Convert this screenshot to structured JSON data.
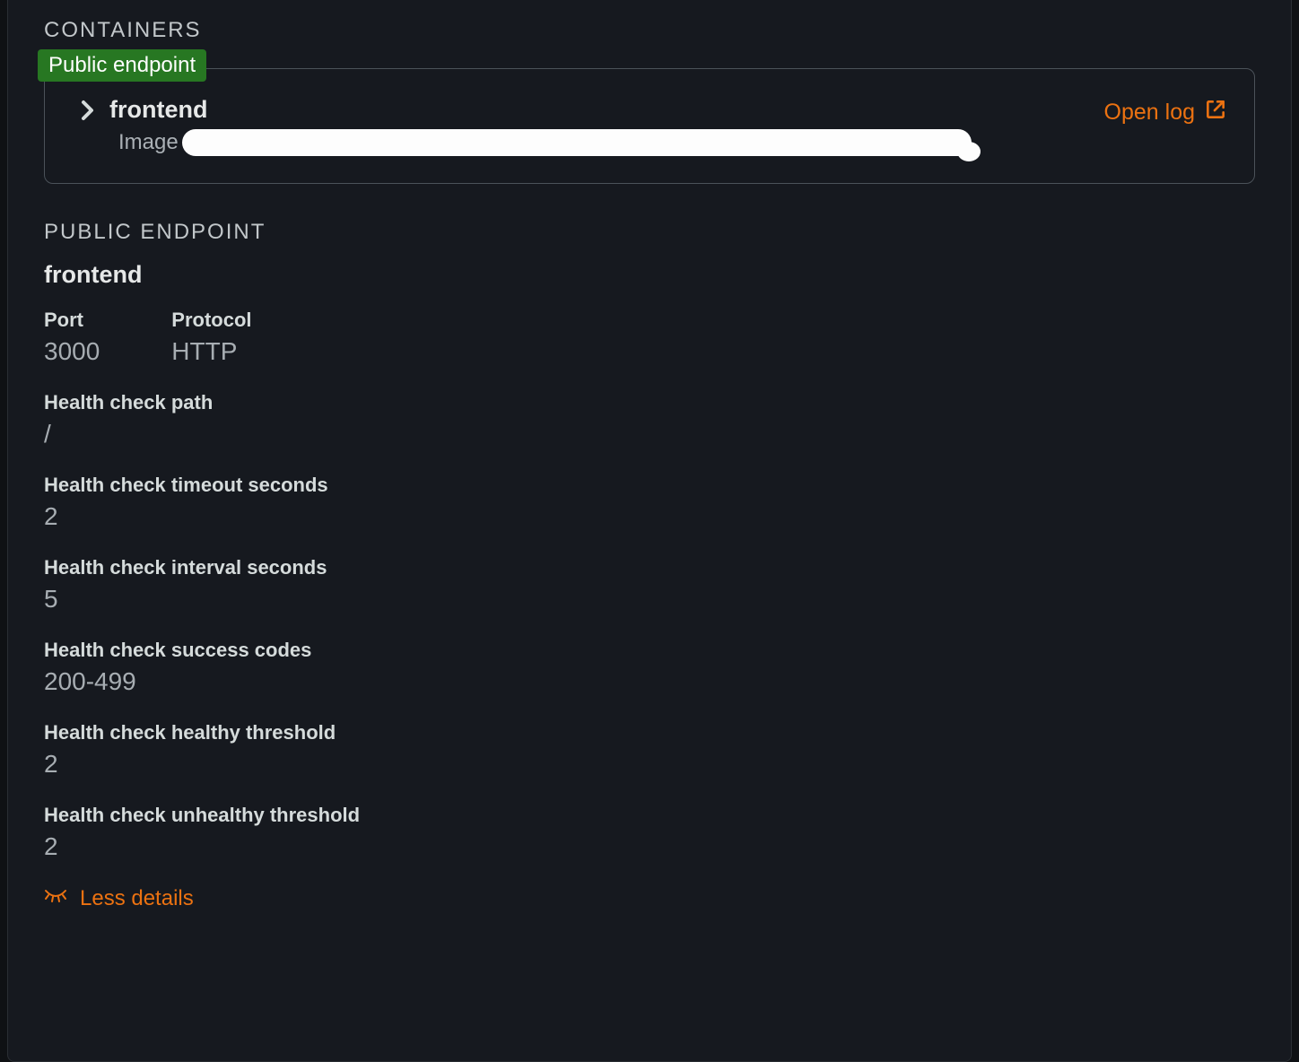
{
  "containers": {
    "section_label": "CONTAINERS",
    "badge": "Public endpoint",
    "name": "frontend",
    "image_label": "Image",
    "open_log_label": "Open log"
  },
  "public_endpoint": {
    "section_label": "PUBLIC ENDPOINT",
    "name": "frontend",
    "port_label": "Port",
    "port_value": "3000",
    "protocol_label": "Protocol",
    "protocol_value": "HTTP",
    "health_path_label": "Health check path",
    "health_path_value": "/",
    "health_timeout_label": "Health check timeout seconds",
    "health_timeout_value": "2",
    "health_interval_label": "Health check interval seconds",
    "health_interval_value": "5",
    "health_success_label": "Health check success codes",
    "health_success_value": "200-499",
    "health_healthy_label": "Health check healthy threshold",
    "health_healthy_value": "2",
    "health_unhealthy_label": "Health check unhealthy threshold",
    "health_unhealthy_value": "2",
    "less_details_label": "Less details"
  }
}
